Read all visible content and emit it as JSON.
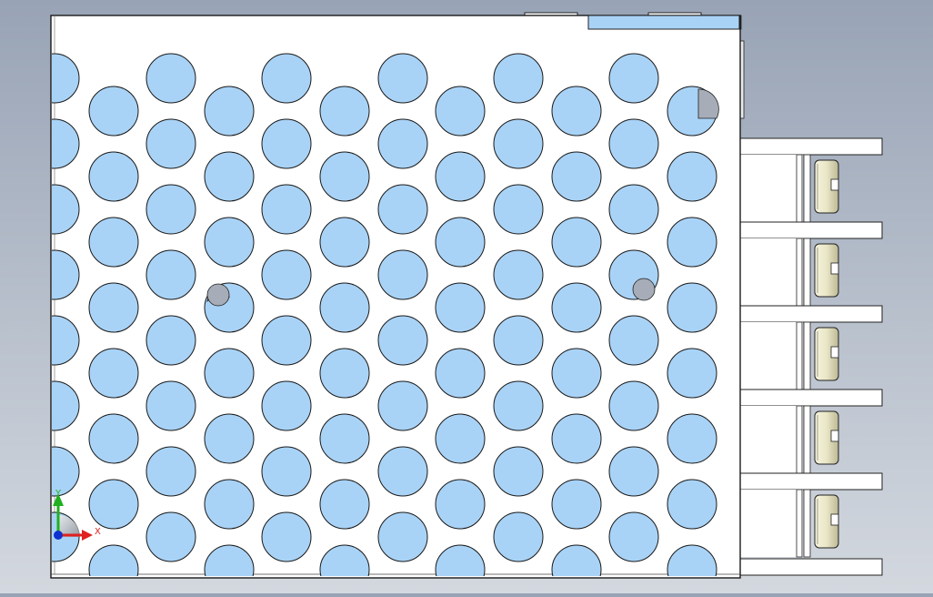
{
  "viewport": {
    "background_top": "#98a3b5",
    "background_bottom": "#d3d8df",
    "plate_color": "#ffffff",
    "hole_color": "#a9d3f6",
    "hole_stroke": "#1a1a1a",
    "boss_color": "#a6adb8",
    "terminal_color": "#e9e6c6"
  },
  "model": {
    "name": "perforated-enclosure-side-view",
    "terminal_count": 5
  },
  "triad": {
    "x_label": "X",
    "y_label": "Y",
    "x_color": "#e02020",
    "y_color": "#20b020",
    "origin_color": "#1030d0"
  }
}
